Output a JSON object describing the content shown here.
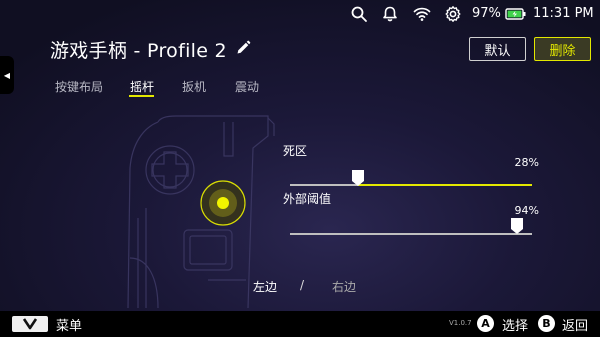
{
  "status_bar": {
    "battery_percent": "97%",
    "time": "11:31 PM",
    "icons": [
      "search-icon",
      "bell-icon",
      "wifi-icon",
      "gear-icon",
      "battery-charging-icon"
    ]
  },
  "side_tab": {
    "arrow": "◀"
  },
  "header": {
    "title": "游戏手柄 - Profile 2",
    "default_label": "默认",
    "delete_label": "删除"
  },
  "tabs": [
    {
      "label": "按键布局",
      "active": false
    },
    {
      "label": "摇杆",
      "active": true
    },
    {
      "label": "扳机",
      "active": false
    },
    {
      "label": "震动",
      "active": false
    }
  ],
  "sliders": {
    "deadzone": {
      "label": "死区",
      "value_text": "28%",
      "value": 0.28
    },
    "outer_threshold": {
      "label": "外部阈值",
      "value_text": "94%",
      "value": 0.94
    }
  },
  "side_switch": {
    "left": "左边",
    "separator": "/",
    "right": "右边"
  },
  "bottom_bar": {
    "menu_label": "菜单",
    "version": "V1.0.7",
    "a_key": "A",
    "a_label": "选择",
    "b_key": "B",
    "b_label": "返回"
  },
  "colors": {
    "accent": "#e3e800",
    "background": "#1b1838"
  }
}
